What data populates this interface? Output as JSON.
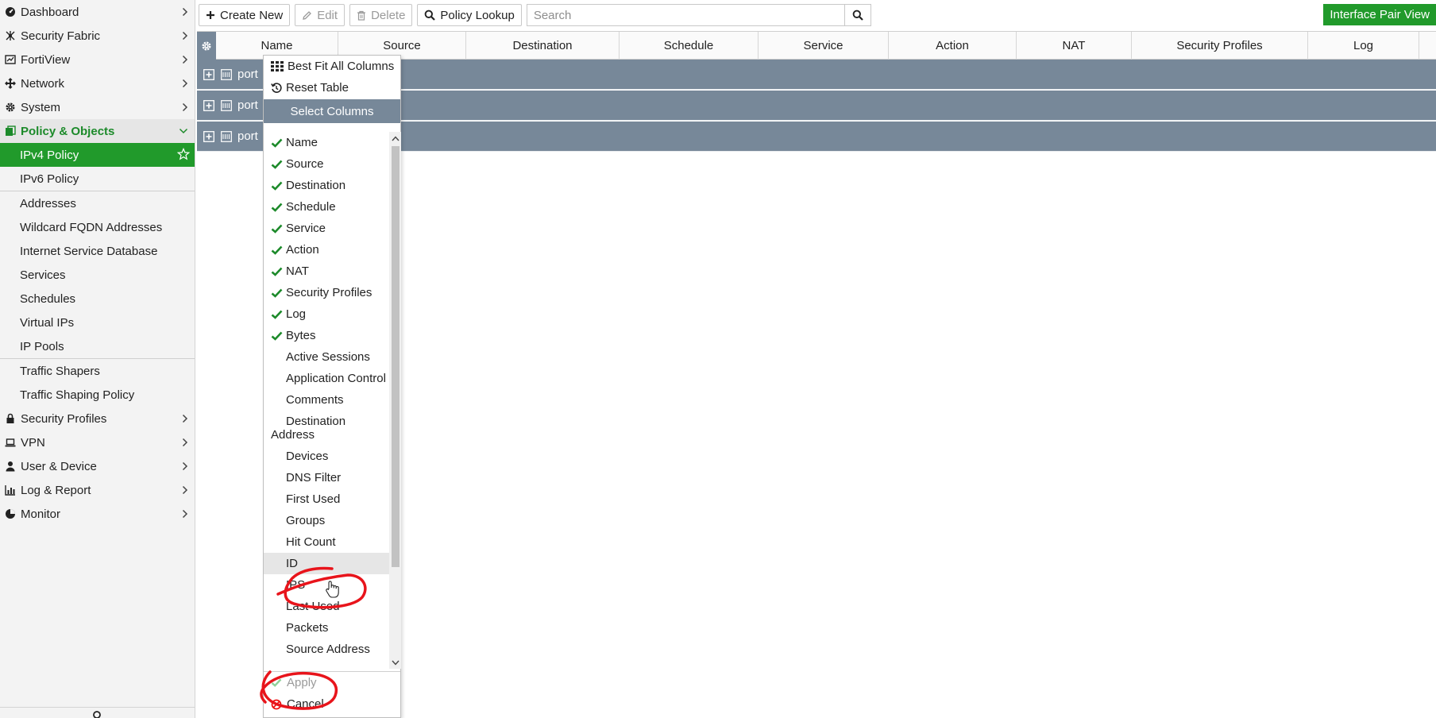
{
  "sidebar": {
    "top_items": [
      {
        "label": "Dashboard",
        "icon": "dashboard-icon"
      },
      {
        "label": "Security Fabric",
        "icon": "security-fabric-icon"
      },
      {
        "label": "FortiView",
        "icon": "fortiview-icon"
      },
      {
        "label": "Network",
        "icon": "network-icon"
      },
      {
        "label": "System",
        "icon": "gear-icon"
      }
    ],
    "active_section": {
      "label": "Policy & Objects",
      "icon": "policy-objects-icon"
    },
    "sub_items": [
      {
        "label": "IPv4 Policy"
      },
      {
        "label": "IPv6 Policy"
      },
      {
        "label": "Addresses"
      },
      {
        "label": "Wildcard FQDN Addresses"
      },
      {
        "label": "Internet Service Database"
      },
      {
        "label": "Services"
      },
      {
        "label": "Schedules"
      },
      {
        "label": "Virtual IPs"
      },
      {
        "label": "IP Pools"
      },
      {
        "label": "Traffic Shapers"
      },
      {
        "label": "Traffic Shaping Policy"
      }
    ],
    "bottom_items": [
      {
        "label": "Security Profiles",
        "icon": "lock-icon"
      },
      {
        "label": "VPN",
        "icon": "laptop-icon"
      },
      {
        "label": "User & Device",
        "icon": "user-icon"
      },
      {
        "label": "Log & Report",
        "icon": "bar-chart-icon"
      },
      {
        "label": "Monitor",
        "icon": "pie-chart-icon"
      }
    ]
  },
  "toolbar": {
    "create_new": "Create New",
    "edit": "Edit",
    "delete": "Delete",
    "policy_lookup": "Policy Lookup",
    "search_placeholder": "Search",
    "interface_pair_view": "Interface Pair View"
  },
  "table": {
    "columns": [
      "Name",
      "Source",
      "Destination",
      "Schedule",
      "Service",
      "Action",
      "NAT",
      "Security Profiles",
      "Log"
    ],
    "group_rows": [
      "port",
      "port",
      "port"
    ]
  },
  "column_menu": {
    "best_fit": "Best Fit All Columns",
    "reset_table": "Reset Table",
    "header": "Select Columns",
    "options": [
      {
        "label": "Name",
        "checked": true
      },
      {
        "label": "Source",
        "checked": true
      },
      {
        "label": "Destination",
        "checked": true
      },
      {
        "label": "Schedule",
        "checked": true
      },
      {
        "label": "Service",
        "checked": true
      },
      {
        "label": "Action",
        "checked": true
      },
      {
        "label": "NAT",
        "checked": true
      },
      {
        "label": "Security Profiles",
        "checked": true
      },
      {
        "label": "Log",
        "checked": true
      },
      {
        "label": "Bytes",
        "checked": true
      },
      {
        "label": "Active Sessions",
        "checked": false
      },
      {
        "label": "Application Control",
        "checked": false
      },
      {
        "label": "Comments",
        "checked": false
      },
      {
        "label": "Destination Address",
        "checked": false
      },
      {
        "label": "Devices",
        "checked": false
      },
      {
        "label": "DNS Filter",
        "checked": false
      },
      {
        "label": "First Used",
        "checked": false
      },
      {
        "label": "Groups",
        "checked": false
      },
      {
        "label": "Hit Count",
        "checked": false
      },
      {
        "label": "ID",
        "checked": false
      },
      {
        "label": "IPS",
        "checked": false
      },
      {
        "label": "Last Used",
        "checked": false
      },
      {
        "label": "Packets",
        "checked": false
      },
      {
        "label": "Source Address",
        "checked": false
      }
    ],
    "apply": "Apply",
    "cancel": "Cancel"
  },
  "colors": {
    "accent_green": "#219a2b",
    "header_slate": "#778899",
    "annotation_red": "#e8141b"
  }
}
